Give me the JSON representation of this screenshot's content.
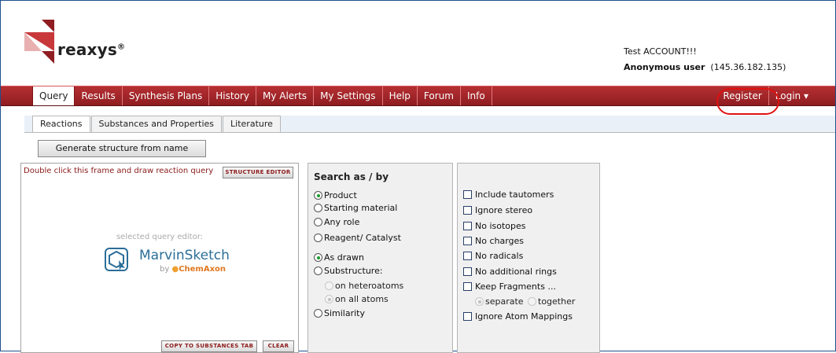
{
  "brand": {
    "name": "reaxys",
    "mark": "®",
    "colors": {
      "accent": "#a02428",
      "link": "#2b6e98"
    }
  },
  "user": {
    "account": "Test ACCOUNT!!!",
    "label": "Anonymous user",
    "ip": "(145.36.182.135)"
  },
  "nav": {
    "items": [
      "Query",
      "Results",
      "Synthesis Plans",
      "History",
      "My Alerts",
      "My Settings",
      "Help",
      "Forum",
      "Info"
    ],
    "active": "Query",
    "register": "Register",
    "login": "Login ▾"
  },
  "tabs": {
    "items": [
      "Reactions",
      "Substances and Properties",
      "Literature"
    ],
    "active": "Reactions"
  },
  "editor": {
    "generate_label": "Generate structure from name",
    "hint": "Double click this frame and draw reaction query",
    "structure_editor": "STRUCTURE EDITOR",
    "selected_label": "selected query editor:",
    "editor_name": "MarvinSketch",
    "by": "by",
    "vendor": "ChemAxon",
    "copy_label": "COPY TO SUBSTANCES TAB",
    "clear_label": "CLEAR"
  },
  "search": {
    "title": "Search as / by",
    "roles": [
      "Product",
      "Starting material",
      "Any role",
      "Reagent/ Catalyst"
    ],
    "modes": [
      "As drawn",
      "Substructure:"
    ],
    "sub_modes": [
      "on heteroatoms",
      "on all atoms"
    ],
    "similarity": "Similarity"
  },
  "options": {
    "checks": [
      "Include tautomers",
      "Ignore stereo",
      "No isotopes",
      "No charges",
      "No radicals",
      "No additional rings",
      "Keep Fragments ...",
      "Ignore Atom Mappings"
    ],
    "fragment_modes": [
      "separate",
      "together"
    ]
  }
}
